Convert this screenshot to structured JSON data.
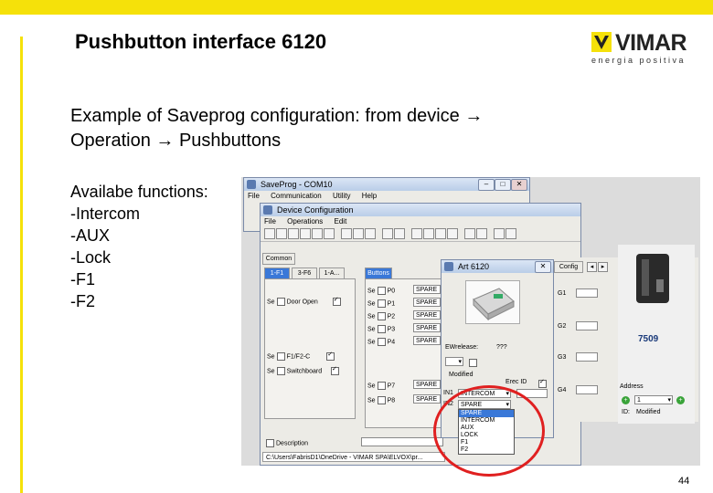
{
  "slide": {
    "title": "Pushbutton interface 6120",
    "description": "Example of Saveprog configuration: from device → Operation → Pushbuttons",
    "functions_heading": "Availabe functions:",
    "functions": [
      "-Intercom",
      "-AUX",
      "-Lock",
      "-F1",
      "-F2"
    ],
    "page_number": "44",
    "accent_color": "#f5e10a"
  },
  "logo": {
    "word": "VIMAR",
    "tagline": "energia positiva"
  },
  "saveprog": {
    "title": "SaveProg - COM10",
    "menu": [
      "File",
      "Communication",
      "Utility",
      "Help"
    ]
  },
  "device_config": {
    "title": "Device Configuration",
    "menu": [
      "File",
      "Operations",
      "Edit"
    ],
    "common_tab": "Common",
    "left_tabs": [
      "1-F1",
      "3-F6",
      "1-A..."
    ],
    "left_rows": [
      {
        "label": "Se",
        "name": "Door Open"
      },
      {
        "label": "Se",
        "name": "F1/F2-C"
      },
      {
        "label": "Se",
        "name": "Switchboard"
      }
    ],
    "mid_tab": "Buttons",
    "mid_rows": [
      {
        "label": "Se",
        "p": "P0",
        "value": "SPARE"
      },
      {
        "label": "Se",
        "p": "P1",
        "value": "SPARE"
      },
      {
        "label": "Se",
        "p": "P2",
        "value": "SPARE"
      },
      {
        "label": "Se",
        "p": "P3",
        "value": "SPARE"
      },
      {
        "label": "Se",
        "p": "P4",
        "value": "SPARE"
      },
      {
        "label": "Se",
        "p": "P7",
        "value": "SPARE"
      },
      {
        "label": "Se",
        "p": "P8",
        "value": "SPARE"
      }
    ],
    "description_label": "Description",
    "path": "C:\\Users\\FabrisD1\\OneDrive - VIMAR SPA\\ELVOX\\pr..."
  },
  "art_window": {
    "title": "Art 6120",
    "ewrelease_label": "EWrelease:",
    "ewrelease_value": "???",
    "modified_label": "Modified",
    "erecid_label": "Erec ID",
    "in1_label": "IN1",
    "in1_value": "INTERCOM",
    "in2_label": "IN2",
    "in2_value": "SPARE",
    "options": [
      "SPARE",
      "INTERCOM",
      "AUX",
      "LOCK",
      "F1",
      "F2"
    ],
    "selected_index": 0
  },
  "right_panel": {
    "tab_label": "Config",
    "rows": [
      "G1",
      "G2",
      "G3",
      "G4"
    ],
    "device_model": "7509",
    "address_label": "Address",
    "address_value": "1",
    "id_label": "ID:",
    "modified_label": "Modified"
  }
}
